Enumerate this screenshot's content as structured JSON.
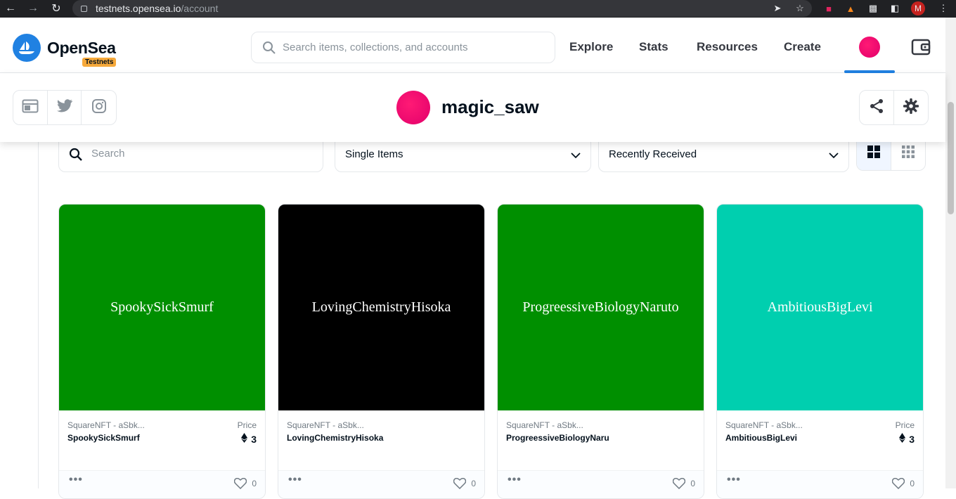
{
  "browser": {
    "url_host": "testnets.opensea.io",
    "url_path": "/account",
    "profile_initial": "M"
  },
  "header": {
    "brand": "OpenSea",
    "badge": "Testnets",
    "search_placeholder": "Search items, collections, and accounts",
    "nav": [
      "Explore",
      "Stats",
      "Resources",
      "Create"
    ]
  },
  "profile": {
    "username": "magic_saw"
  },
  "filters": {
    "search_placeholder": "Search",
    "item_type": "Single Items",
    "sort": "Recently Received"
  },
  "cards": [
    {
      "art_text": "SpookySickSmurf",
      "art_color": "#008f00",
      "collection": "SquareNFT - aSbk...",
      "name": "SpookySickSmurf",
      "price_label": "Price",
      "price": "3",
      "likes": "0"
    },
    {
      "art_text": "LovingChemistryHisoka",
      "art_color": "#000000",
      "collection": "SquareNFT - aSbk...",
      "name": "LovingChemistryHisoka",
      "price_label": "",
      "price": "",
      "likes": "0"
    },
    {
      "art_text": "ProgreessiveBiologyNaruto",
      "art_color": "#008f00",
      "collection": "SquareNFT - aSbk...",
      "name": "ProgreessiveBiologyNaru",
      "price_label": "",
      "price": "",
      "likes": "0"
    },
    {
      "art_text": "AmbitiousBigLevi",
      "art_color": "#00cfaf",
      "collection": "SquareNFT - aSbk...",
      "name": "AmbitiousBigLevi",
      "price_label": "Price",
      "price": "3",
      "likes": "0"
    }
  ],
  "colors": {
    "accent": "#2081e2",
    "avatar": "#e2006b",
    "badge": "#f6a93b"
  }
}
